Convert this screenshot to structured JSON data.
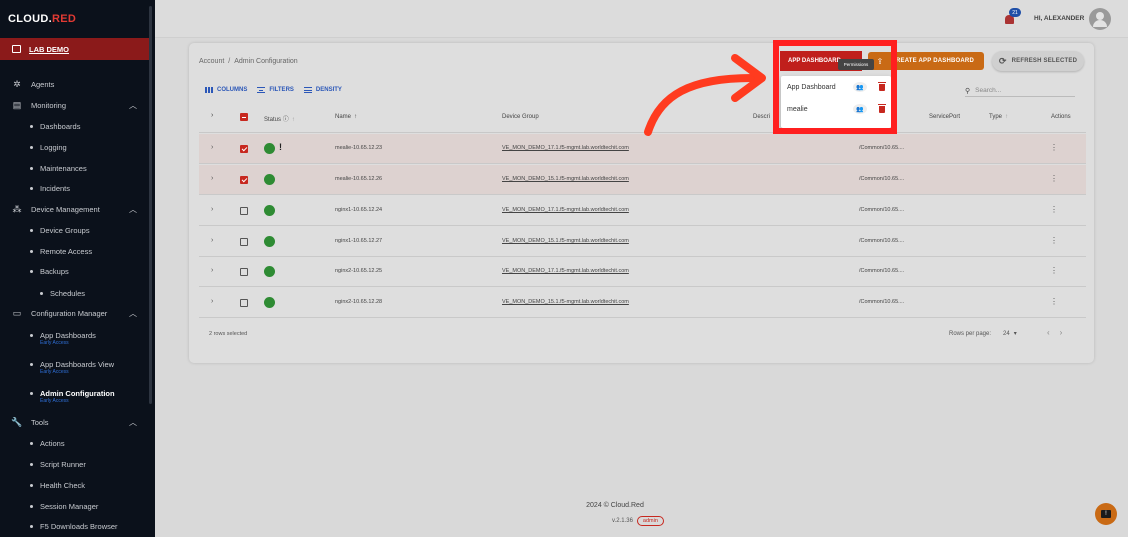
{
  "brand": {
    "part1": "CL",
    "mid": "O",
    "part2": "UD.",
    "red": "RED"
  },
  "sidebar": {
    "lab": "LAB DEMO",
    "items": [
      {
        "label": "Agents",
        "icon": "agents-icon"
      },
      {
        "label": "Monitoring",
        "icon": "monitoring-icon"
      },
      {
        "label": "Device Management",
        "icon": "device-management-icon"
      },
      {
        "label": "Configuration Manager",
        "icon": "monitor-icon"
      },
      {
        "label": "Tools",
        "icon": "wrench-icon"
      }
    ],
    "sub": {
      "dashboards": "Dashboards",
      "logging": "Logging",
      "maintenances": "Maintenances",
      "incidents": "Incidents",
      "device_groups": "Device Groups",
      "remote_access": "Remote Access",
      "backups": "Backups",
      "schedules": "Schedules",
      "app_dashboards": "App Dashboards",
      "app_dashboards_view": "App Dashboards View",
      "admin_configuration": "Admin Configuration",
      "actions": "Actions",
      "script_runner": "Script Runner",
      "health_check": "Health Check",
      "session_manager": "Session Manager",
      "f5_downloads": "F5 Downloads Browser"
    },
    "early_access": "Early Access"
  },
  "topbar": {
    "badge": "21",
    "greeting": "HI, ALEXANDER"
  },
  "breadcrumb": {
    "root": "Account",
    "sep": "/",
    "current": "Admin Configuration"
  },
  "buttons": {
    "app_dashboard": "APP DASHBOARD",
    "create_app_dashboard": "CREATE APP DASHBOARD",
    "refresh_selected": "REFRESH SELECTED"
  },
  "toolbar": {
    "columns": "COLUMNS",
    "filters": "FILTERS",
    "density": "DENSITY",
    "search_placeholder": "Search..."
  },
  "table": {
    "headers": {
      "status": "Status",
      "name": "Name",
      "device_group": "Device Group",
      "description": "Descri",
      "service_port": "ServicePort",
      "type": "Type",
      "actions": "Actions"
    },
    "rows": [
      {
        "name": "mealie-10.65.12.23",
        "device_group": "VE_MON_DEMO_17.1.f5-mgmt.lab.worldtechit.com",
        "path": "/Common/10.65....",
        "checked": true,
        "warn": "!"
      },
      {
        "name": "mealie-10.65.12.26",
        "device_group": "VE_MON_DEMO_15.1.f5-mgmt.lab.worldtechit.com",
        "path": "/Common/10.65....",
        "checked": true,
        "warn": ""
      },
      {
        "name": "nginx1-10.65.12.24",
        "device_group": "VE_MON_DEMO_17.1.f5-mgmt.lab.worldtechit.com",
        "path": "/Common/10.65....",
        "checked": false,
        "warn": ""
      },
      {
        "name": "nginx1-10.65.12.27",
        "device_group": "VE_MON_DEMO_15.1.f5-mgmt.lab.worldtechit.com",
        "path": "/Common/10.65....",
        "checked": false,
        "warn": ""
      },
      {
        "name": "nginx2-10.65.12.25",
        "device_group": "VE_MON_DEMO_17.1.f5-mgmt.lab.worldtechit.com",
        "path": "/Common/10.65....",
        "checked": false,
        "warn": ""
      },
      {
        "name": "nginx2-10.65.12.28",
        "device_group": "VE_MON_DEMO_15.1.f5-mgmt.lab.worldtechit.com",
        "path": "/Common/10.65....",
        "checked": false,
        "warn": ""
      }
    ],
    "selected_text": "2 rows selected",
    "rows_per_page_label": "Rows per page:",
    "rows_per_page": "24"
  },
  "popover": {
    "items": [
      "App Dashboard",
      "mealie"
    ],
    "tooltip": "Permissions"
  },
  "footer": {
    "copyright": "2024 © Cloud.Red",
    "version": "v.2.1.36",
    "role": "admin"
  },
  "colors": {
    "accent": "#b5201e",
    "orange": "#c96a15",
    "highlight": "#ff1f1f",
    "status_ok": "#2e8b33"
  }
}
